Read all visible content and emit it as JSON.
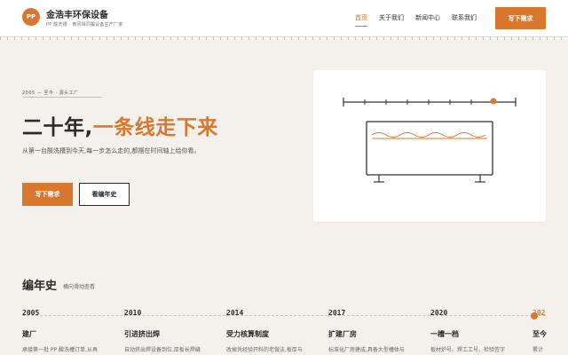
{
  "brand": {
    "badge": "PP",
    "name": "金浩丰环保设备",
    "tagline": "PP 酸洗槽 · 黄冈靖同覆设备生产厂家"
  },
  "nav": {
    "items": [
      "首页",
      "关于我们",
      "新闻中心",
      "联系我们"
    ],
    "active_index": 0,
    "cta": "写下需求"
  },
  "hero": {
    "eyebrow": "2005 — 至今 · 源头工厂",
    "title_plain": "二十年,",
    "title_accent": "一条线走下来",
    "description": "从第一台酸洗槽到今天,每一步怎么走的,都摆在时间轴上给你看。",
    "primary_button": "写下需求",
    "secondary_button": "看编年史"
  },
  "chronicle": {
    "title": "编年史",
    "hint": "横向滑动查看",
    "items": [
      {
        "year": "2005",
        "title": "建厂",
        "desc": "承接第一批 PP 酸洗槽订单,从再"
      },
      {
        "year": "2010",
        "title": "引进挤出焊",
        "desc": "自动挤出焊设备到位,厚板长焊缝"
      },
      {
        "year": "2014",
        "title": "受力核算制度",
        "desc": "改掉凭经验开料的老做法,板厚与"
      },
      {
        "year": "2017",
        "title": "扩建厂房",
        "desc": "标准化厂房建成,具备大型槽体与"
      },
      {
        "year": "2020",
        "title": "一槽一档",
        "desc": "板材炉号、焊工工号、检验签字"
      },
      {
        "year": "202",
        "title": "至今",
        "desc": "累计"
      }
    ]
  },
  "colors": {
    "accent": "#d9772e",
    "background": "#f4f1ec",
    "text": "#2b2b2b"
  },
  "icons": {
    "illustration": "tank-on-timeline-illustration"
  }
}
